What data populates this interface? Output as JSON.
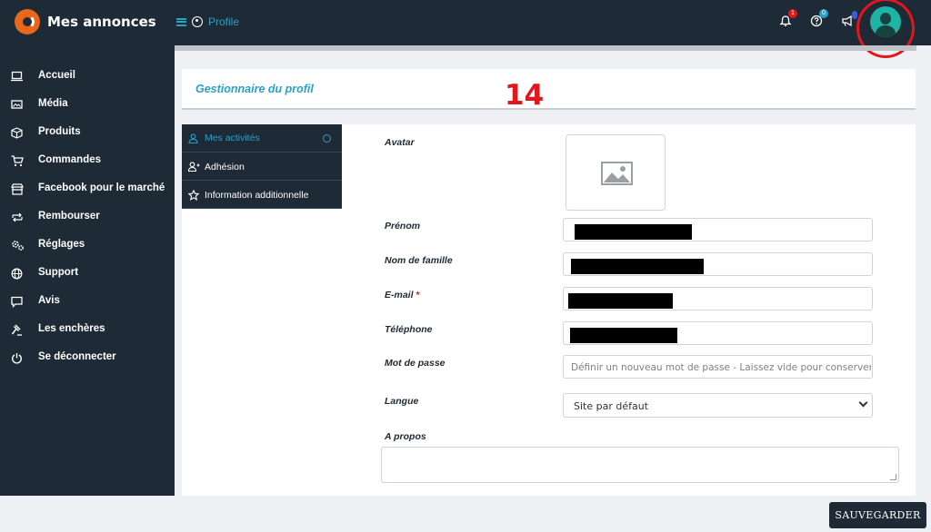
{
  "app": {
    "title": "Mes annonces",
    "breadcrumb": "Profile"
  },
  "topbar": {
    "notifications_badge": "1",
    "help_badge": "0",
    "badge_colors": {
      "notifications": "#e3161e",
      "help": "#2aa0c6",
      "announce": "#3b5bdb"
    }
  },
  "sidebar": {
    "items": [
      {
        "label": "Accueil",
        "icon": "laptop-icon"
      },
      {
        "label": "Média",
        "icon": "image-icon"
      },
      {
        "label": "Produits",
        "icon": "box-icon"
      },
      {
        "label": "Commandes",
        "icon": "cart-icon"
      },
      {
        "label": "Facebook pour le marché",
        "icon": "store-icon"
      },
      {
        "label": "Rembourser",
        "icon": "refund-icon"
      },
      {
        "label": "Réglages",
        "icon": "settings-icon"
      },
      {
        "label": "Support",
        "icon": "globe-icon"
      },
      {
        "label": "Avis",
        "icon": "comment-icon"
      },
      {
        "label": "Les enchères",
        "icon": "gavel-icon"
      },
      {
        "label": "Se déconnecter",
        "icon": "power-icon"
      }
    ]
  },
  "header": {
    "title": "Gestionnaire du profil",
    "step_number": "14"
  },
  "tabs": [
    {
      "label": "Mes activités",
      "icon": "user-icon",
      "active": true
    },
    {
      "label": "Adhésion",
      "icon": "user-plus-icon",
      "active": false
    },
    {
      "label": "Information additionnelle",
      "icon": "star-icon",
      "active": false
    }
  ],
  "form": {
    "avatar_label": "Avatar",
    "first_name_label": "Prénom",
    "last_name_label": "Nom de famille",
    "email_label": "E-mail",
    "email_required": "*",
    "phone_label": "Téléphone",
    "password_label": "Mot de passe",
    "password_placeholder": "Définir un nouveau mot de passe - Laissez vide pour conserver",
    "language_label": "Langue",
    "language_value": "Site par défaut",
    "about_label": "A propos"
  },
  "footer": {
    "save_label": "SAUVEGARDER"
  },
  "colors": {
    "dark": "#1e2a35",
    "accent": "#2aa0c6",
    "annotation": "#e3161e"
  }
}
